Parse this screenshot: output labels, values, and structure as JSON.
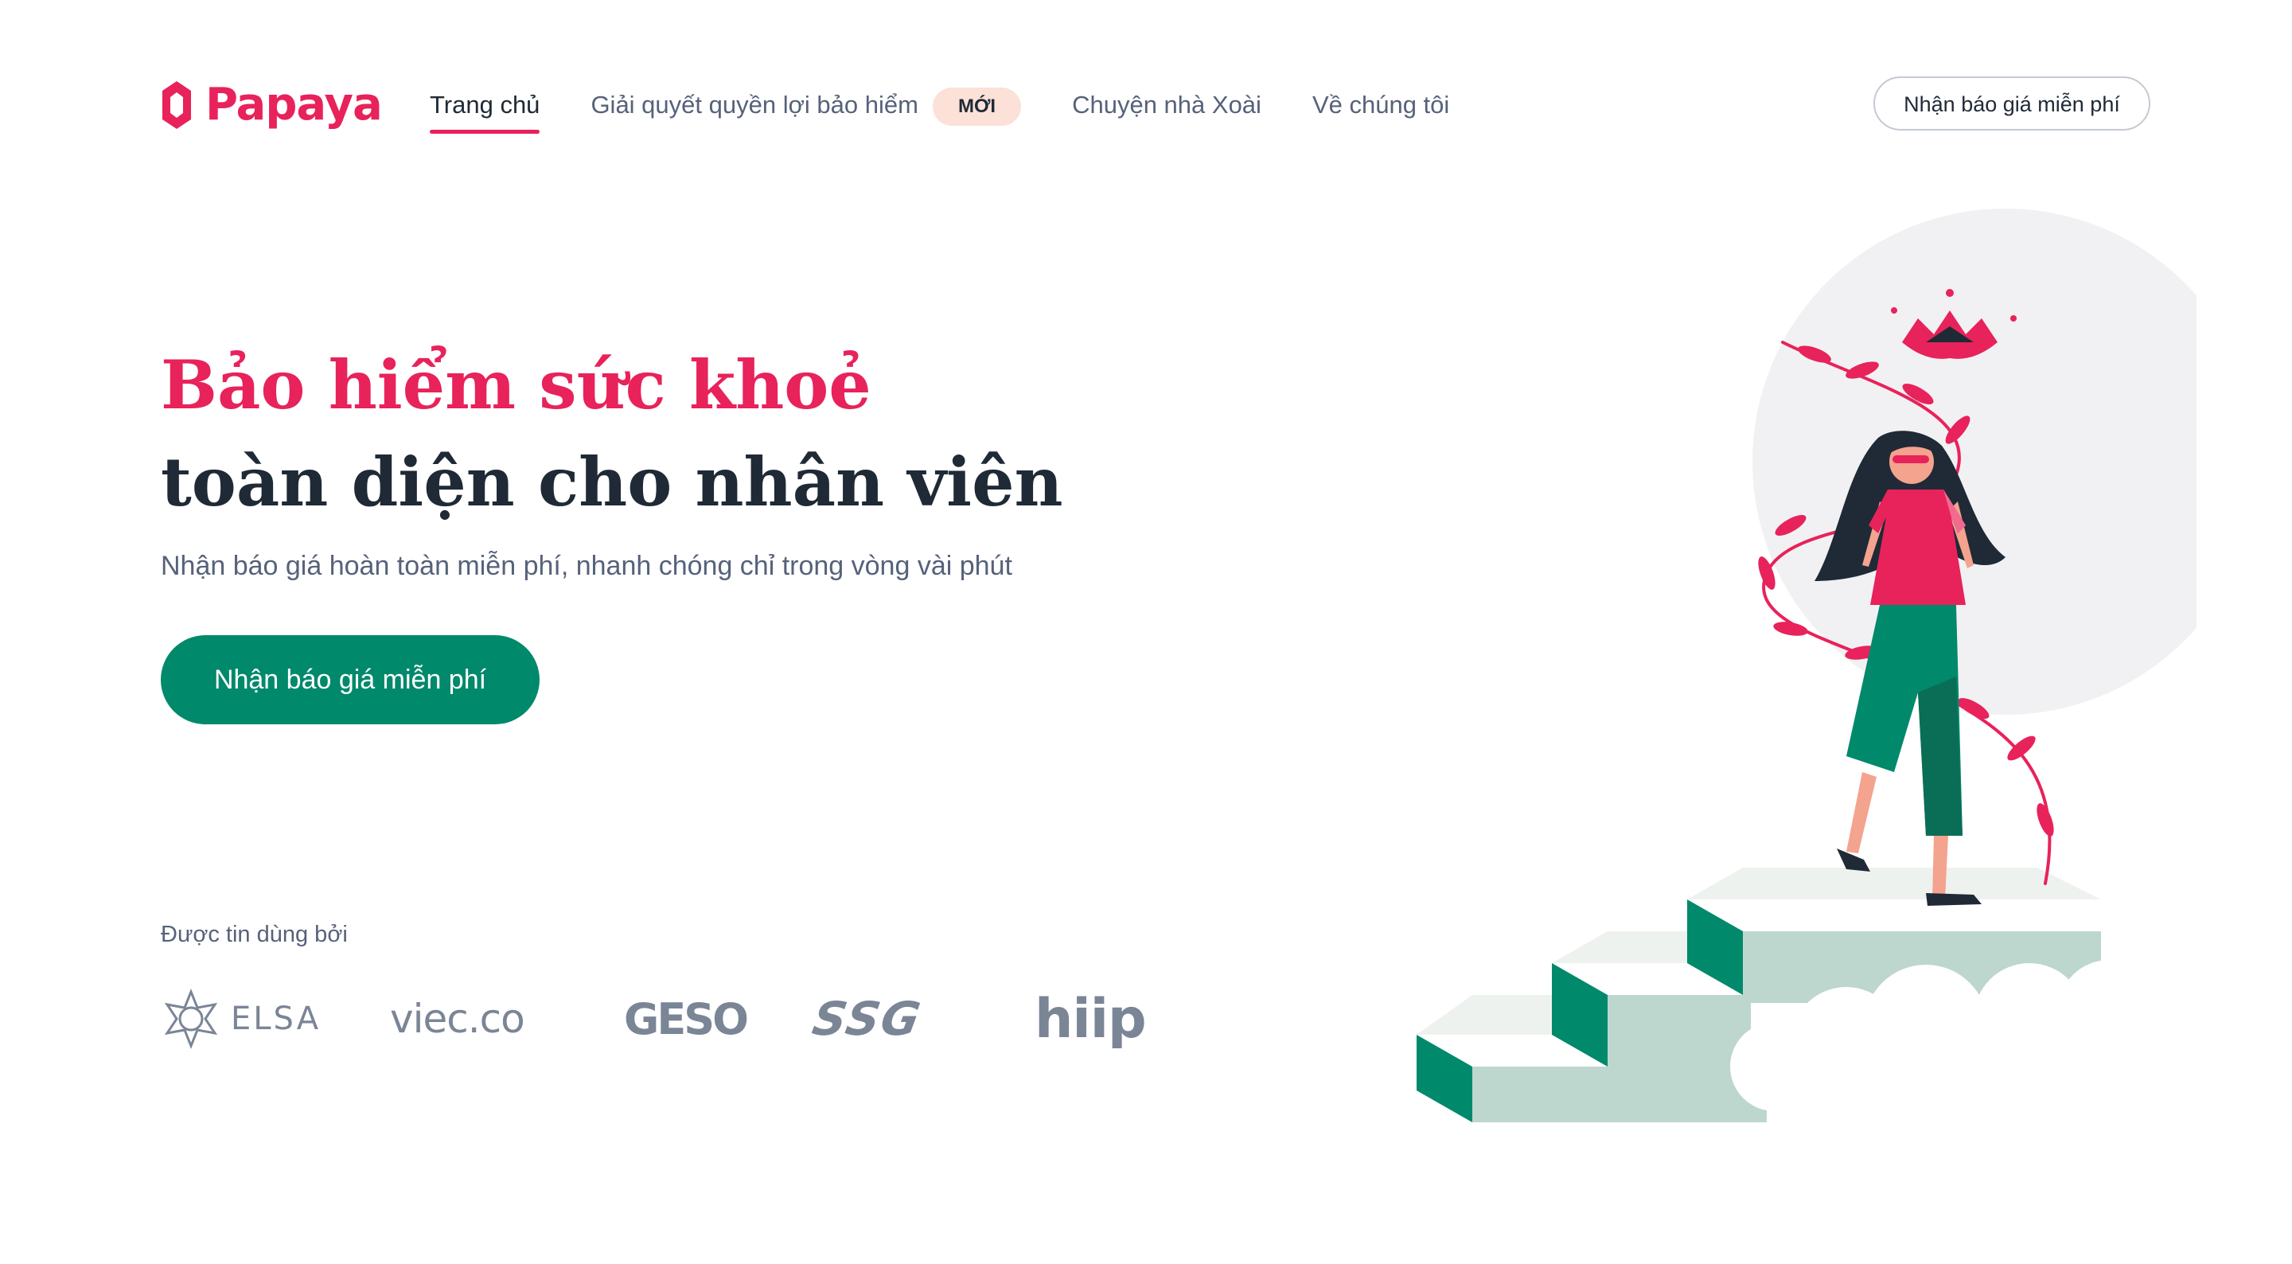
{
  "brand": {
    "name": "Papaya",
    "color": "#e8225a"
  },
  "nav": {
    "items": [
      {
        "label": "Trang chủ",
        "active": true
      },
      {
        "label": "Giải quyết quyền lợi bảo hiểm",
        "badge": "MỚI"
      },
      {
        "label": "Chuyện nhà Xoài"
      },
      {
        "label": "Về chúng tôi"
      }
    ],
    "cta_label": "Nhận báo giá miễn phí"
  },
  "hero": {
    "title_line1": "Bảo hiểm sức khoẻ",
    "title_line2": "toàn diện cho nhân viên",
    "subtitle": "Nhận báo giá hoàn toàn miễn phí, nhanh chóng chỉ trong vòng vài phút",
    "cta_label": "Nhận báo giá miễn phí"
  },
  "trusted": {
    "label": "Được tin dùng bởi",
    "partners": [
      "ELSA",
      "viec.co",
      "GESO",
      "SSG",
      "hiip"
    ]
  },
  "colors": {
    "primary": "#e8225a",
    "accent_green": "#00896b",
    "text_dark": "#1f2a36",
    "text_muted": "#56627a",
    "badge_bg": "#fbe1d8"
  },
  "icons": {
    "logo": "papaya-logo-icon",
    "illustration": "woman-walking-up-stairs-illustration"
  }
}
